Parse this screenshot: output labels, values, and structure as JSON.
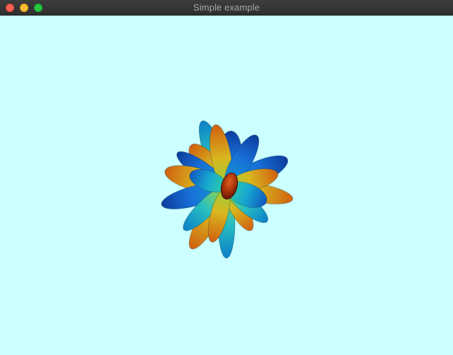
{
  "window": {
    "title": "Simple example",
    "buttons": {
      "close": "close-icon",
      "minimize": "minimize-icon",
      "zoom": "zoom-icon"
    }
  },
  "viewport": {
    "background_color": "#ccffff",
    "object": "3d-petal-glyph",
    "colormap": [
      "#1040c0",
      "#10a0d0",
      "#20c8b8",
      "#b8d020",
      "#e0a010",
      "#d05010",
      "#a02808"
    ]
  }
}
